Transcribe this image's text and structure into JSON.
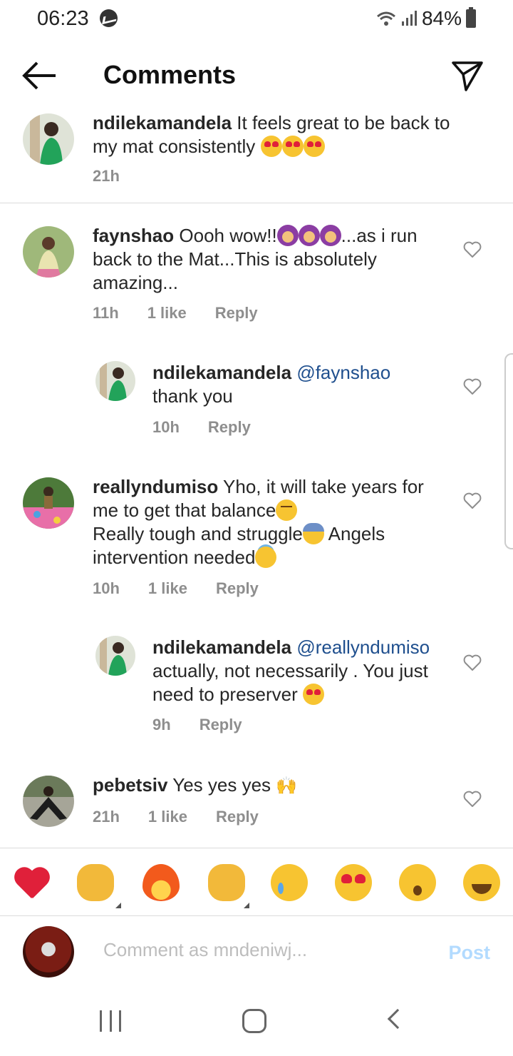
{
  "status": {
    "time": "06:23",
    "battery": "84%"
  },
  "header": {
    "title": "Comments"
  },
  "caption": {
    "user": "ndilekamandela",
    "text": " It feels great to be back to my mat consistently ",
    "time": "21h"
  },
  "comments": [
    {
      "user": "faynshao",
      "text_a": " Oooh wow!!",
      "text_b": "...as i run back to the Mat...This is absolutely amazing...",
      "time": "11h",
      "likes": "1 like",
      "reply": "Reply"
    },
    {
      "user": "ndilekamandela",
      "mention": "@faynshao",
      "text": " thank you",
      "time": "10h",
      "reply": "Reply"
    },
    {
      "user": "reallyndumiso",
      "text_a": " Yho, it will take years for me to get that balance",
      "text_b": "Really tough and struggle",
      "text_c": " Angels intervention needed",
      "time": "10h",
      "likes": "1 like",
      "reply": "Reply"
    },
    {
      "user": "ndilekamandela",
      "mention": "@reallyndumiso",
      "text": " actually, not necessarily . You just need to preserver ",
      "time": "9h",
      "reply": "Reply"
    },
    {
      "user": "pebetsiv",
      "text": " Yes yes yes ",
      "time": "21h",
      "likes": "1 like",
      "reply": "Reply"
    }
  ],
  "reactions": [
    "red-heart",
    "raising-hands",
    "fire",
    "clapping-hands",
    "crying-face",
    "heart-eyes",
    "surprised-face",
    "tears-of-joy"
  ],
  "composer": {
    "placeholder": "Comment as mndeniwj...",
    "post": "Post"
  },
  "colors": {
    "mention": "#1f4f8e",
    "post_disabled": "#b3dbff",
    "meta": "#8e8e8e"
  }
}
